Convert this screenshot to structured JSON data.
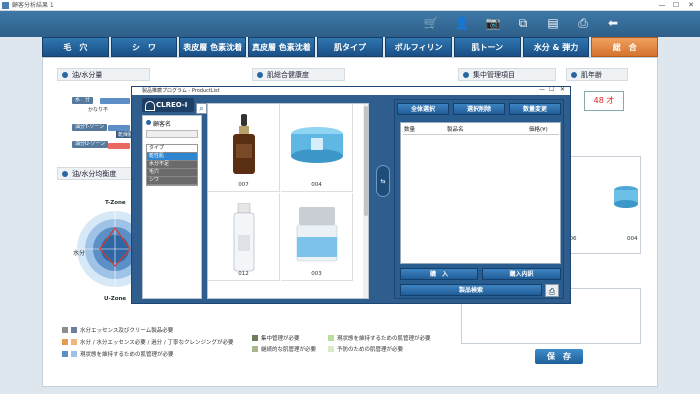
{
  "window": {
    "title": "顧客分析結果 1",
    "minimize": "—",
    "maximize": "☐",
    "close": "✕"
  },
  "toolbar": {
    "icons": [
      "cart-icon",
      "user-icon",
      "camera-icon",
      "copy-icon",
      "document-icon",
      "printer-icon",
      "back-arrow-icon"
    ],
    "glyphs": [
      "🛒",
      "👤",
      "📷",
      "⧉",
      "▤",
      "⎙",
      "⬅"
    ]
  },
  "tabs": [
    {
      "label": "毛　穴",
      "active": false
    },
    {
      "label": "シ　ワ",
      "active": false
    },
    {
      "label": "表皮層 色素沈着",
      "active": false
    },
    {
      "label": "真皮層 色素沈着",
      "active": false
    },
    {
      "label": "肌タイプ",
      "active": false
    },
    {
      "label": "ポルフィリン",
      "active": false
    },
    {
      "label": "肌トーン",
      "active": false
    },
    {
      "label": "水分 & 弾力",
      "active": false
    },
    {
      "label": "総　合",
      "active": true
    }
  ],
  "sections": {
    "oil_water": "油/水分量",
    "skin_health": "肌総合健康度",
    "focus_items": "集中管理項目",
    "skin_age": "肌年齢",
    "balance": "油/水分均衡度"
  },
  "bars": {
    "oil_label": "水　分",
    "moist_text": "かなり不",
    "tzone_label": "油分T-ゾーン",
    "uzone_label": "油分U-ゾーン",
    "dry_text": "乾燥肌"
  },
  "radar": {
    "tzone": "T-Zone",
    "uzone": "U-Zone",
    "water": "水分"
  },
  "skin_age_value": "48 才",
  "right_product_caps": [
    "006",
    "004"
  ],
  "legend_left": [
    {
      "text": "水分エッセンス及びクリーム製品必要",
      "color": "#8c8c8c"
    },
    {
      "text": "水分 / 水分エッセンス必要 / 過分 / 丁寧なクレンジングが必要",
      "color": "#e59a4f"
    },
    {
      "text": "現状態を維持するための肌管理が必要",
      "color": "#5b8fc6"
    }
  ],
  "legend_mid": [
    {
      "text": "集中管理が必要",
      "color": "#6b7d5a"
    },
    {
      "text": "継続的な肌管理が必要",
      "color": "#a7b88e"
    },
    {
      "text": "現状態を維持するための肌管理が必要",
      "color": "#b9dd9e"
    },
    {
      "text": "予防のための肌管理が必要",
      "color": "#d8ecc6"
    }
  ],
  "save_label": "保　存",
  "dialog": {
    "title": "製品推薦プログラム - ProductList",
    "logo": "CLREO-I",
    "customer_label": "顧客名",
    "search_icon": "⌕",
    "list_items": [
      {
        "label": "タイプ",
        "state": "header"
      },
      {
        "label": "乾性肌",
        "state": "selected"
      },
      {
        "label": "水分不足",
        "state": "normal"
      },
      {
        "label": "毛穴",
        "state": "normal"
      },
      {
        "label": "シワ",
        "state": "normal"
      }
    ],
    "products": [
      {
        "caption": "007",
        "kind": "dropper-bottle"
      },
      {
        "caption": "004",
        "kind": "cream-jar-blue"
      },
      {
        "caption": "012",
        "kind": "clear-bottle"
      },
      {
        "caption": "003",
        "kind": "cream-jar-silver"
      }
    ],
    "transfer_icon": "⇆",
    "buttons": {
      "select_all": "全体選択",
      "delete_selection": "選択削除",
      "change_qty": "数量変更",
      "purchase": "購　入",
      "purchase_history": "購入内訳",
      "product_search": "製品検索"
    },
    "table_headers": {
      "qty": "数量",
      "name": "製品名",
      "price": "価格(¥)"
    }
  }
}
